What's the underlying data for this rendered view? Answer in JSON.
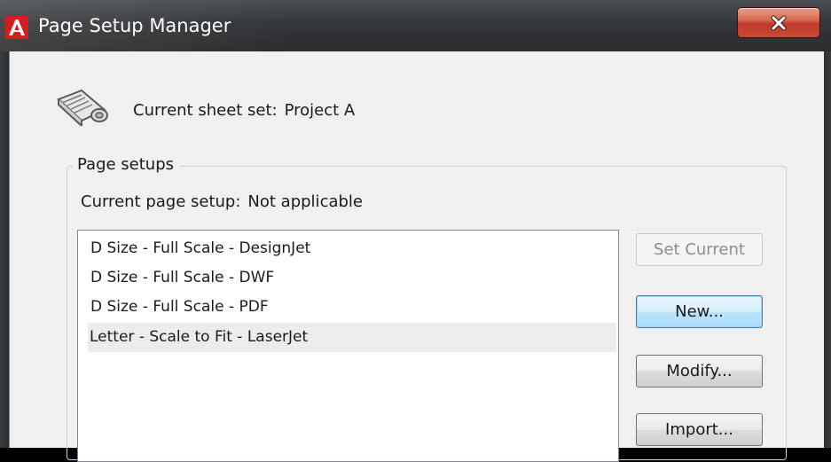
{
  "window": {
    "title": "Page Setup Manager",
    "close_label": "x"
  },
  "sheet_set": {
    "label": "Current sheet set:",
    "value": "Project A"
  },
  "page_setups": {
    "group_label": "Page setups",
    "current_label": "Current page setup:",
    "current_value": "Not applicable",
    "items": [
      "D Size - Full Scale - DesignJet",
      "D Size - Full Scale - DWF",
      "D Size - Full Scale - PDF",
      "Letter - Scale to Fit - LaserJet"
    ],
    "highlighted_index": 3
  },
  "buttons": {
    "set_current": "Set Current",
    "new": "New...",
    "modify": "Modify...",
    "import": "Import..."
  },
  "icons": {
    "app": "autocad-logo-icon",
    "sheet_set": "sheet-roll-icon",
    "close": "close-icon"
  },
  "colors": {
    "titlebar": "#2b2d2f",
    "close_button": "#c84a35",
    "app_icon": "#d41e1e",
    "client_bg": "#f0f0f0",
    "default_button_border": "#3c7fb1"
  }
}
